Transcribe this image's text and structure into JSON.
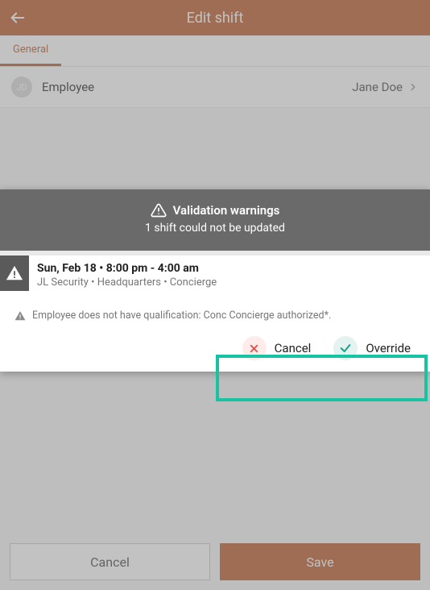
{
  "header": {
    "title": "Edit shift"
  },
  "tabs": {
    "general": "General"
  },
  "employee_row": {
    "label": "Employee",
    "value": "Jane Doe",
    "initials": "JD"
  },
  "footer": {
    "cancel": "Cancel",
    "save": "Save"
  },
  "modal": {
    "title": "Validation warnings",
    "subtitle": "1 shift could not be updated",
    "shift": {
      "title": "Sun, Feb 18 • 8:00 pm - 4:00 am",
      "subtitle": "JL Security • Headquarters • Concierge"
    },
    "warning": "Employee does not have qualification: Conc Concierge authorized*.",
    "cancel": "Cancel",
    "override": "Override"
  }
}
